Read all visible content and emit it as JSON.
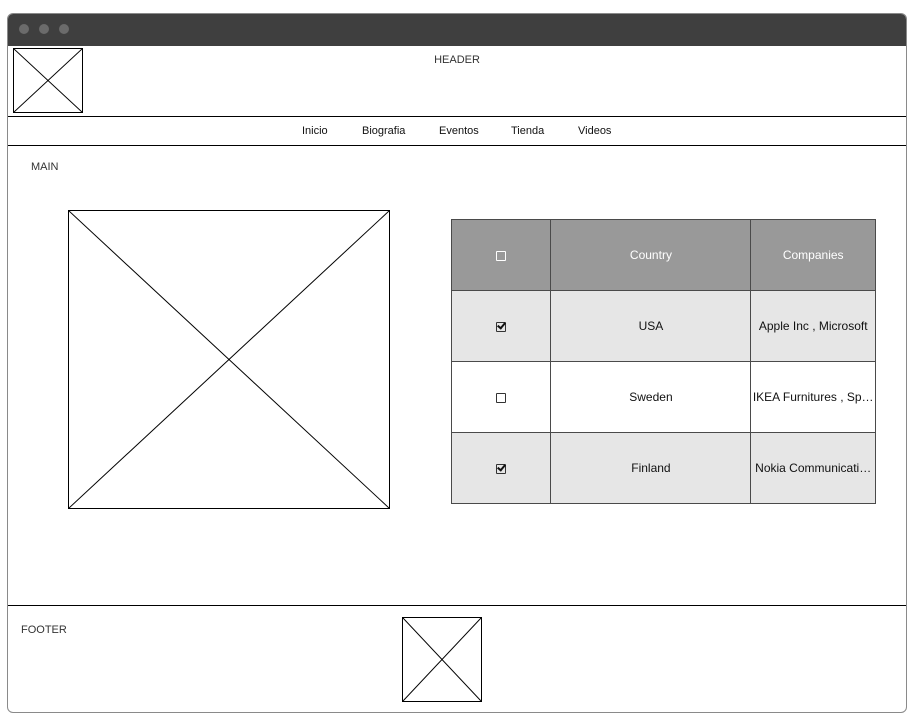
{
  "window": {
    "controls": [
      "close-dot",
      "minimize-dot",
      "maximize-dot"
    ]
  },
  "header": {
    "label": "HEADER",
    "logo_icon": "image-placeholder-icon"
  },
  "nav": {
    "items": [
      {
        "label": "Inicio"
      },
      {
        "label": "Biografia"
      },
      {
        "label": "Eventos"
      },
      {
        "label": "Tienda"
      },
      {
        "label": "Videos"
      }
    ]
  },
  "main": {
    "label": "MAIN",
    "image_icon": "image-placeholder-icon",
    "table": {
      "header": {
        "select_all_checked": false,
        "columns": [
          "Country",
          "Companies"
        ]
      },
      "rows": [
        {
          "checked": true,
          "country": "USA",
          "companies": "Apple Inc , Microsoft"
        },
        {
          "checked": false,
          "country": "Sweden",
          "companies": "IKEA Furnitures , Sp…"
        },
        {
          "checked": true,
          "country": "Finland",
          "companies": "Nokia Communicati…"
        }
      ]
    }
  },
  "footer": {
    "label": "FOOTER",
    "logo_icon": "image-placeholder-icon"
  },
  "colors": {
    "titlebar": "#3f3f3f",
    "table_header_bg": "#999999",
    "table_row_alt_bg": "#e6e6e6"
  }
}
